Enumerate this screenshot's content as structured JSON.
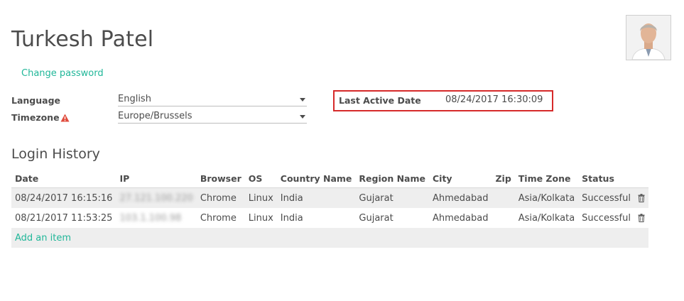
{
  "user": {
    "name": "Turkesh Patel",
    "change_password": "Change password"
  },
  "preferences": {
    "language_label": "Language",
    "language_value": "English",
    "timezone_label": "Timezone",
    "timezone_value": "Europe/Brussels"
  },
  "last_active": {
    "label": "Last Active Date",
    "value": "08/24/2017 16:30:09"
  },
  "login_history": {
    "title": "Login History",
    "columns": [
      "Date",
      "IP",
      "Browser",
      "OS",
      "Country Name",
      "Region Name",
      "City",
      "Zip",
      "Time Zone",
      "Status"
    ],
    "rows": [
      {
        "date": "08/24/2017 16:15:16",
        "ip": "27.121.100.220",
        "browser": "Chrome",
        "os": "Linux",
        "country": "India",
        "region": "Gujarat",
        "city": "Ahmedabad",
        "zip": "",
        "tz": "Asia/Kolkata",
        "status": "Successful"
      },
      {
        "date": "08/21/2017 11:53:25",
        "ip": "103.1.100.98",
        "browser": "Chrome",
        "os": "Linux",
        "country": "India",
        "region": "Gujarat",
        "city": "Ahmedabad",
        "zip": "",
        "tz": "Asia/Kolkata",
        "status": "Successful"
      }
    ],
    "add_item": "Add an item"
  },
  "colors": {
    "accent": "#21b799",
    "highlight": "#d62a2a",
    "warning": "#e04b3c"
  }
}
